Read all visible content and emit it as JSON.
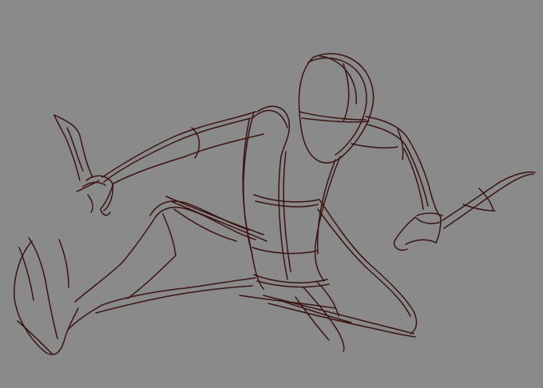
{
  "artwork": {
    "kind": "gesture sketch",
    "background_color": "#8a8a8a",
    "ink_color": "#3a1412"
  }
}
